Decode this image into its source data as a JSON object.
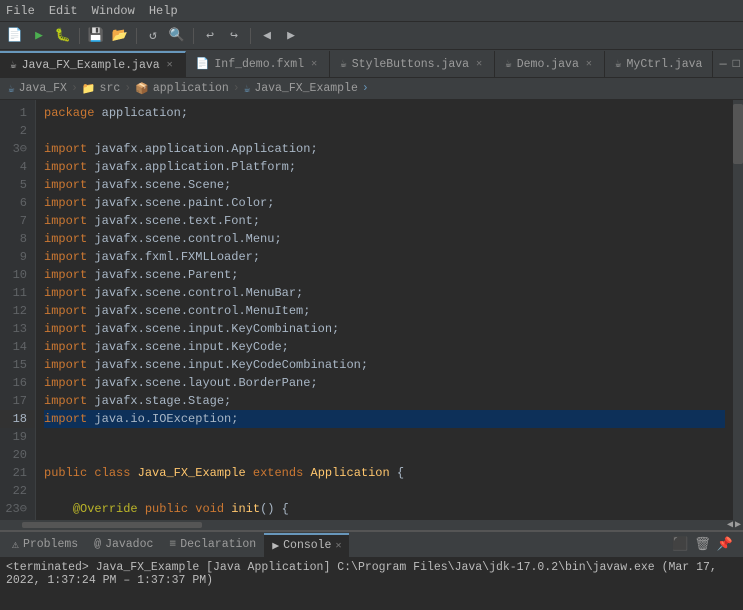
{
  "menu": {
    "items": [
      "File",
      "Edit",
      "Window",
      "Help"
    ]
  },
  "tabs": [
    {
      "id": "java_fx",
      "icon": "☕",
      "label": "Java_FX_Example.java",
      "active": true,
      "closable": true
    },
    {
      "id": "inf_demo",
      "icon": "📄",
      "label": "Inf_demo.fxml",
      "active": false,
      "closable": true
    },
    {
      "id": "style_buttons",
      "icon": "☕",
      "label": "StyleButtons.java",
      "active": false,
      "closable": true
    },
    {
      "id": "demo",
      "icon": "☕",
      "label": "Demo.java",
      "active": false,
      "closable": true
    },
    {
      "id": "myctrl",
      "icon": "☕",
      "label": "MyCtrl.java",
      "active": false,
      "closable": false
    }
  ],
  "tab_corner": {
    "minimize": "—",
    "maximize": "□"
  },
  "breadcrumb": {
    "items": [
      "Java_FX",
      "src",
      "application",
      "Java_FX_Example"
    ]
  },
  "bottom_tabs": [
    {
      "id": "problems",
      "icon": "⚠",
      "label": "Problems",
      "active": false
    },
    {
      "id": "javadoc",
      "icon": "@",
      "label": "Javadoc",
      "active": false
    },
    {
      "id": "declaration",
      "icon": "≡",
      "label": "Declaration",
      "active": false
    },
    {
      "id": "console",
      "icon": "▶",
      "label": "Console",
      "active": true,
      "closable": true
    }
  ],
  "console_text": "<terminated> Java_FX_Example [Java Application] C:\\Program Files\\Java\\jdk-17.0.2\\bin\\javaw.exe (Mar 17, 2022, 1:37:24 PM – 1:37:37 PM)"
}
